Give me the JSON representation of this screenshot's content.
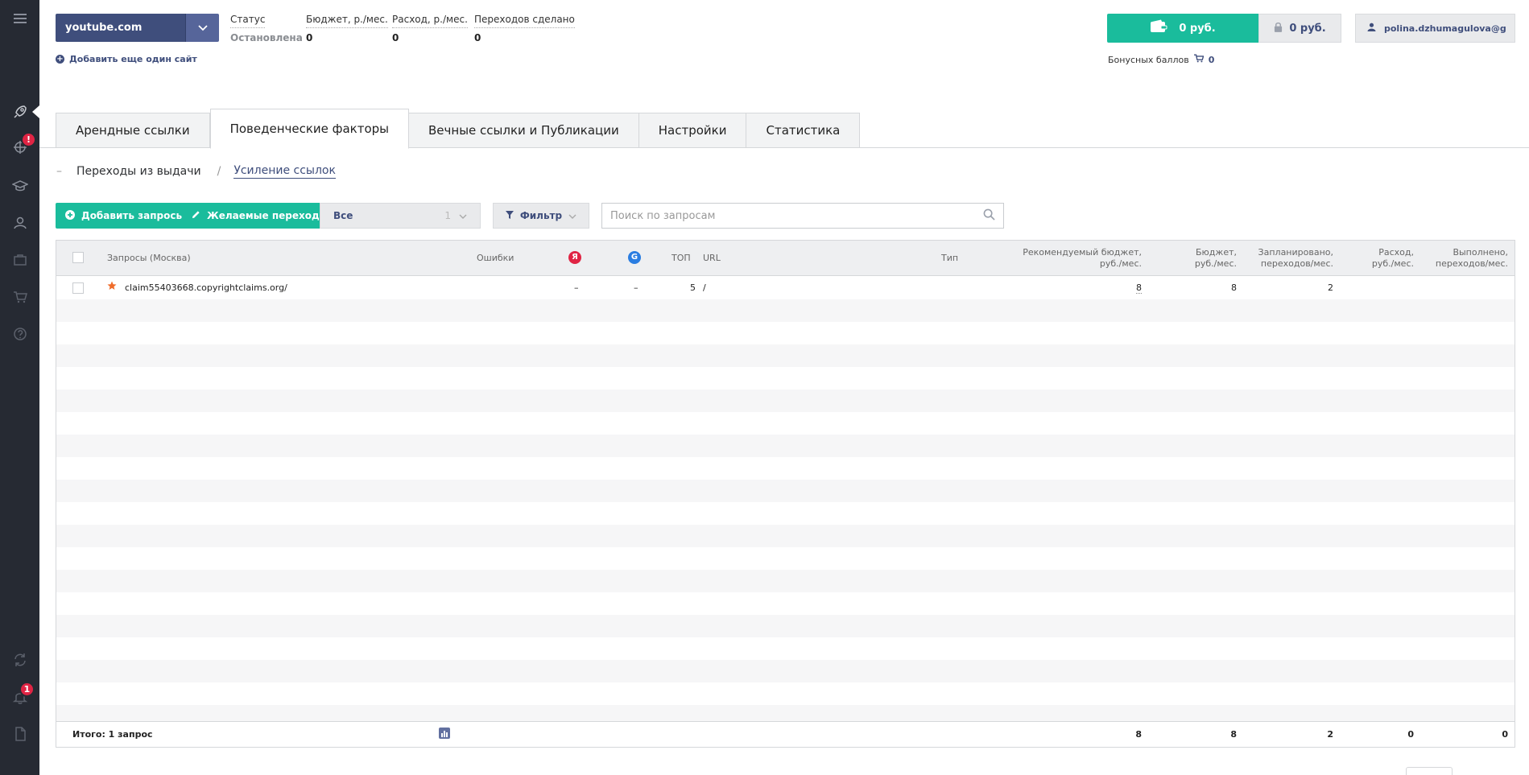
{
  "header": {
    "site_name": "youtube.com",
    "add_site": "Добавить еще один сайт",
    "stats": [
      {
        "label": "Статус",
        "value": "Остановлена"
      },
      {
        "label": "Бюджет, р./мес.",
        "value": "0"
      },
      {
        "label": "Расход, р./мес.",
        "value": "0"
      },
      {
        "label": "Переходов сделано",
        "value": "0"
      }
    ],
    "balance": "0 руб.",
    "locked_balance": "0 руб.",
    "user": "polina.dzhumagulova@g",
    "bonus_label": "Бонусных баллов",
    "bonus_value": "0"
  },
  "sidebar": {
    "alerts_badge": "!",
    "notifications_badge": "1"
  },
  "tabs": [
    {
      "label": "Арендные ссылки"
    },
    {
      "label": "Поведенческие факторы"
    },
    {
      "label": "Вечные ссылки и Публикации"
    },
    {
      "label": "Настройки"
    },
    {
      "label": "Статистика"
    }
  ],
  "subnav": {
    "item1": "Переходы из выдачи",
    "item2": "Усиление ссылок"
  },
  "toolbar": {
    "add_queries": "Добавить запросы",
    "desired_transitions": "Желаемые переходы",
    "select_value": "Все",
    "select_count": "1",
    "filter": "Фильтр",
    "search_placeholder": "Поиск по запросам"
  },
  "table": {
    "headers": {
      "query": "Запросы (Москва)",
      "errors": "Ошибки",
      "yandex": "Я",
      "google": "G",
      "top": "ТОП",
      "url": "URL",
      "type": "Тип",
      "rec_budget_1": "Рекомендуемый бюджет,",
      "rec_budget_2": "руб./мес.",
      "budget_1": "Бюджет,",
      "budget_2": "руб./мес.",
      "planned_1": "Запланировано,",
      "planned_2": "переходов/мес.",
      "spend_1": "Расход,",
      "spend_2": "руб./мес.",
      "done_1": "Выполнено,",
      "done_2": "переходов/мес."
    },
    "rows": [
      {
        "query": "claim55403668.copyrightclaims.org/",
        "yandex": "–",
        "google": "–",
        "top": "5",
        "url": "/",
        "rec_budget": "8",
        "budget": "8",
        "planned": "2"
      }
    ],
    "footer": {
      "total_label": "Итого: 1 запрос",
      "rec_budget": "8",
      "budget": "8",
      "planned": "2",
      "spend": "0",
      "done": "0"
    }
  },
  "colors": {
    "accent_green": "#1abc9c",
    "navy": "#3f4e7c",
    "sidebar_bg": "#262a33",
    "badge_red": "#e02444",
    "star_orange": "#ef6c2a"
  }
}
